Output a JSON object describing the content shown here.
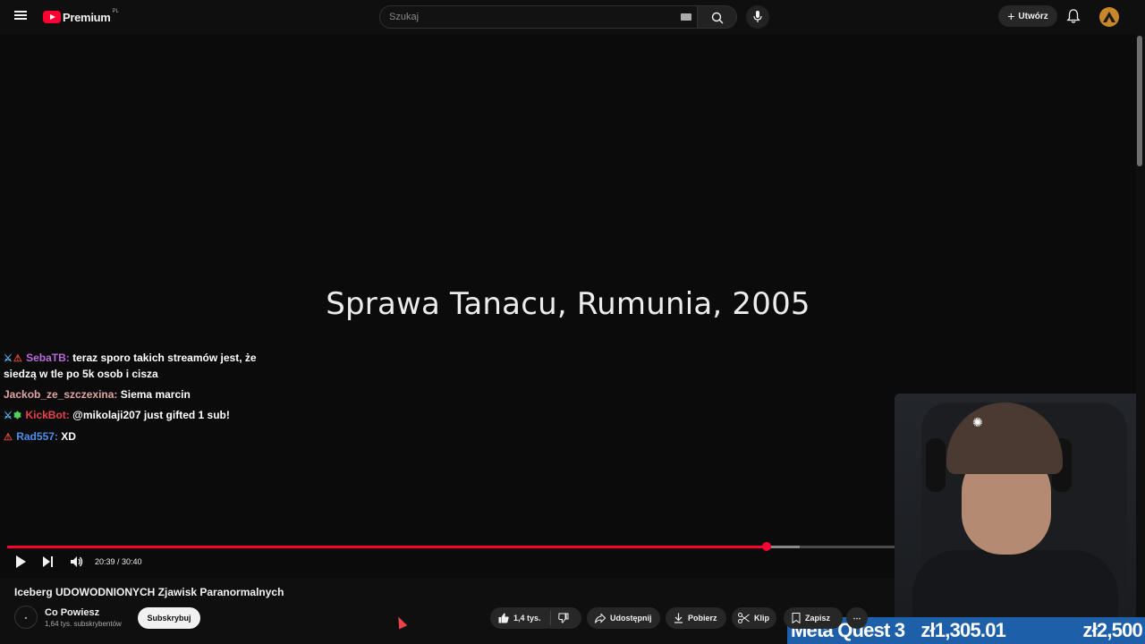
{
  "header": {
    "logo_text": "Premium",
    "logo_region": "PL",
    "search_placeholder": "Szukaj",
    "create_label": "Utwórz"
  },
  "video": {
    "overlay_title": "Sprawa Tanacu, Rumunia, 2005",
    "time_current": "20:39",
    "time_total": "30:40",
    "time_display": "20:39 / 30:40",
    "progress_played": 0.673,
    "progress_buffered": 0.702
  },
  "chat": [
    {
      "user": "SebaTB:",
      "user_color": "#b76ad9",
      "message": "teraz sporo takich streamów jest, że siedzą w tle po 5k osob i cisza",
      "badges": [
        "sword-icon",
        "warning-icon"
      ]
    },
    {
      "user": "Jackob_ze_szczexina:",
      "user_color": "#e0a5a5",
      "message": "Siema marcin",
      "badges": []
    },
    {
      "user": "KickBot:",
      "user_color": "#e8434c",
      "message": "@mikolaji207 just gifted 1 sub!",
      "badges": [
        "sword-icon",
        "gift-icon"
      ]
    },
    {
      "user": "Rad557:",
      "user_color": "#4f8ee8",
      "message": "XD",
      "badges": [
        "warning-icon"
      ]
    }
  ],
  "ticker": {
    "goal_name": "Meta Quest 3",
    "current": "zł1,305.01",
    "target": "zł2,500"
  },
  "watch": {
    "title": "Iceberg UDOWODNIONYCH Zjawisk Paranormalnych",
    "channel_name": "Co Powiesz",
    "channel_subs": "1,64 tys. subskrybentów",
    "subscribe_label": "Subskrybuj",
    "likes": "1,4 tys.",
    "share_label": "Udostępnij",
    "download_label": "Pobierz",
    "clip_label": "Klip",
    "save_label": "Zapisz"
  },
  "colors": {
    "accent": "#ff0033",
    "background": "#0f0f0f",
    "ticker_bg": "#1d5fa8"
  }
}
